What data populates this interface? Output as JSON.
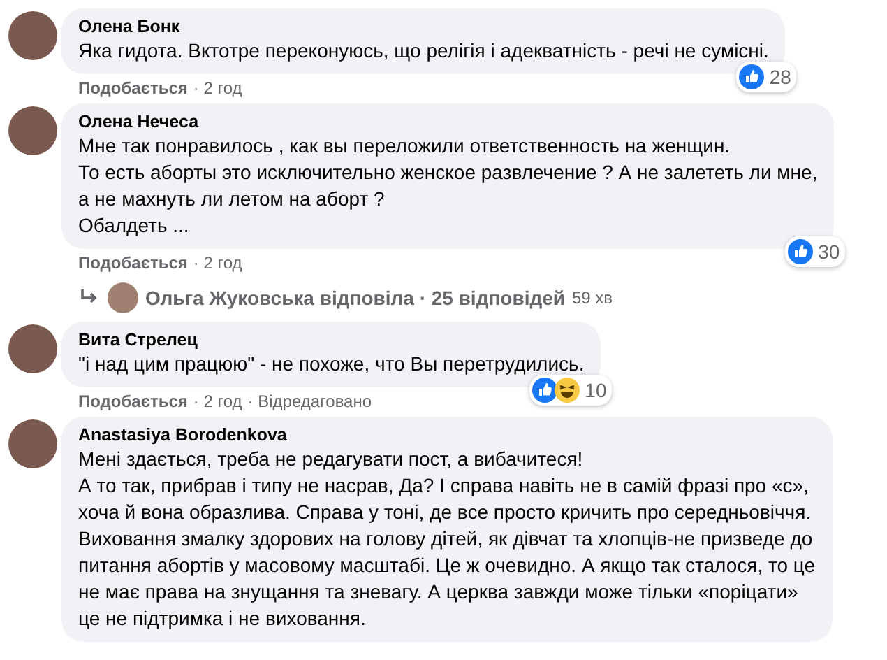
{
  "comments": [
    {
      "author": "Олена Бонк",
      "text": "Яка гидота. Вктотре переконуюсь, що релігія і адекватність - речі не сумісні.",
      "reactions": [
        {
          "kind": "like"
        }
      ],
      "reaction_count": "28",
      "like_label": "Подобається",
      "time": "· 2 год"
    },
    {
      "author": "Олена Нечеса",
      "text": "Мне так понравилось , как вы переложили ответственность на женщин.\nТо есть аборты это исключительно женское развлечение ? А не залететь ли мне,\nа не махнуть ли летом на аборт ?\nОбалдеть ...",
      "reactions": [
        {
          "kind": "like"
        }
      ],
      "reaction_count": "30",
      "like_label": "Подобається",
      "time": "· 2 год",
      "replies": {
        "summary": "Ольга Жуковська відповіла · 25 відповідей",
        "time": "59 хв"
      }
    },
    {
      "author": "Вита Стрелец",
      "text": "\"і над цим працюю\" - не похоже, что Вы перетрудились.",
      "reactions": [
        {
          "kind": "like"
        },
        {
          "kind": "haha"
        }
      ],
      "reaction_count": "10",
      "like_label": "Подобається",
      "time": "· 2 год",
      "edited": "· Відредаговано"
    },
    {
      "author": "Anastasiya Borodenkova",
      "text": "Мені здається, треба не редагувати пост, а вибачитеся!\nА то так, прибрав і типу не насрав, Да? І справа навіть не в самій фразі про «с»,\nхоча й вона образлива. Справа у тоні, де все просто кричить про середньовіччя.\nВиховання змалку здорових на голову дітей, як дівчат та хлопців-не призведе до\nпитання абортів у масовому масштабі. Це ж очевидно. А якщо так сталося, то це\nне має права на знущання та зневагу. А церква завжди може тільки «поріцати»\nце не підтримка і не виховання."
    }
  ]
}
